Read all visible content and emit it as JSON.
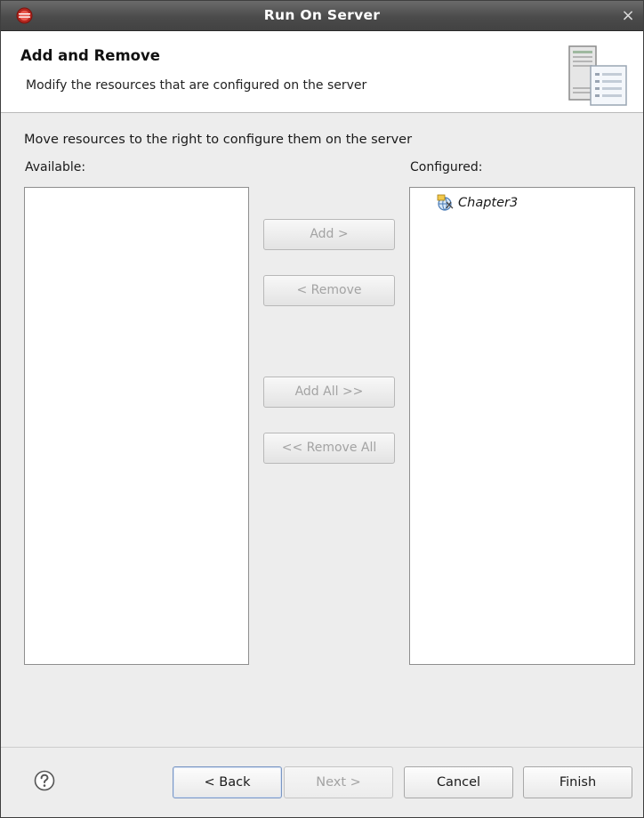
{
  "window": {
    "title": "Run On Server",
    "close_glyph": "×",
    "app_icon": "eclipse-icon"
  },
  "header": {
    "title": "Add and Remove",
    "description": "Modify the resources that are configured on the server",
    "icon": "server-wizard-icon"
  },
  "body": {
    "instruction": "Move resources to the right to configure them on the server",
    "available_label": "Available:",
    "configured_label": "Configured:",
    "available_items": [],
    "configured_items": [
      {
        "label": "Chapter3",
        "icon": "web-project-icon"
      }
    ]
  },
  "buttons": {
    "add": "Add >",
    "remove": "< Remove",
    "add_all": "Add All >>",
    "remove_all": "<< Remove All"
  },
  "footer": {
    "help_icon": "help-icon",
    "back": "< Back",
    "next": "Next >",
    "cancel": "Cancel",
    "finish": "Finish"
  }
}
